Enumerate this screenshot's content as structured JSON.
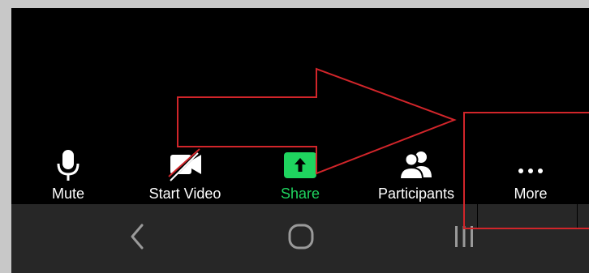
{
  "toolbar": {
    "mute": {
      "label": "Mute",
      "icon": "microphone-icon"
    },
    "start_video": {
      "label": "Start Video",
      "icon": "video-off-icon"
    },
    "share": {
      "label": "Share",
      "icon": "share-up-arrow-icon",
      "color": "#1fd45f"
    },
    "participants": {
      "label": "Participants",
      "icon": "participants-icon"
    },
    "more": {
      "label": "More",
      "icon": "ellipsis-icon"
    }
  },
  "navbar": {
    "back": {
      "icon": "back-chevron-icon"
    },
    "home": {
      "icon": "home-circle-icon"
    },
    "recents": {
      "icon": "recents-bars-icon"
    }
  },
  "annotation": {
    "color": "#d1252a",
    "arrow_shape": "arrow-right",
    "box_target": "more-button"
  }
}
